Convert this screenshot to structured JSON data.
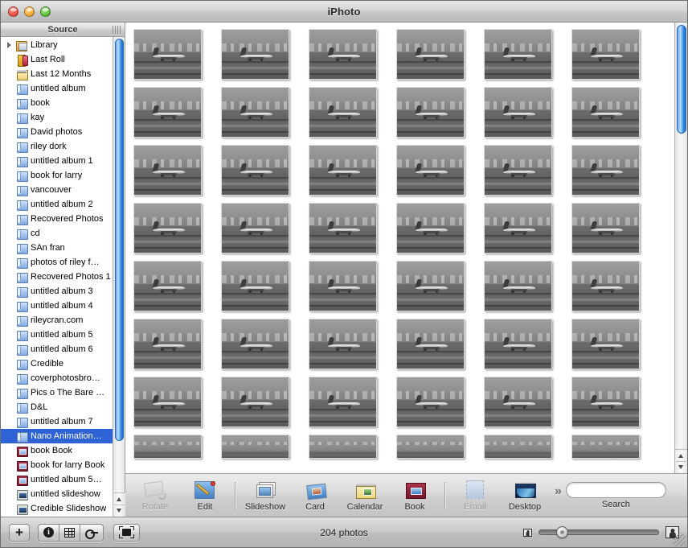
{
  "window": {
    "title": "iPhoto",
    "controls": {
      "close": "close-button",
      "minimize": "minimize-button",
      "zoom": "zoom-button"
    }
  },
  "sidebar": {
    "header": "Source",
    "items": [
      {
        "label": "Library",
        "icon": "library-icon",
        "disclosure": true,
        "selected": false
      },
      {
        "label": "Last Roll",
        "icon": "film-roll-icon",
        "disclosure": false,
        "selected": false
      },
      {
        "label": "Last 12 Months",
        "icon": "calendar-icon",
        "disclosure": false,
        "selected": false
      },
      {
        "label": "untitled album",
        "icon": "album-icon",
        "disclosure": false,
        "selected": false
      },
      {
        "label": "book",
        "icon": "album-icon",
        "disclosure": false,
        "selected": false
      },
      {
        "label": "kay",
        "icon": "album-icon",
        "disclosure": false,
        "selected": false
      },
      {
        "label": "David photos",
        "icon": "album-icon",
        "disclosure": false,
        "selected": false
      },
      {
        "label": "riley dork",
        "icon": "album-icon",
        "disclosure": false,
        "selected": false
      },
      {
        "label": "untitled album 1",
        "icon": "album-icon",
        "disclosure": false,
        "selected": false
      },
      {
        "label": "book for larry",
        "icon": "album-icon",
        "disclosure": false,
        "selected": false
      },
      {
        "label": "vancouver",
        "icon": "album-icon",
        "disclosure": false,
        "selected": false
      },
      {
        "label": "untitled album 2",
        "icon": "album-icon",
        "disclosure": false,
        "selected": false
      },
      {
        "label": "Recovered Photos",
        "icon": "album-icon",
        "disclosure": false,
        "selected": false
      },
      {
        "label": "cd",
        "icon": "album-icon",
        "disclosure": false,
        "selected": false
      },
      {
        "label": "SAn fran",
        "icon": "album-icon",
        "disclosure": false,
        "selected": false
      },
      {
        "label": "photos of riley f…",
        "icon": "album-icon",
        "disclosure": false,
        "selected": false
      },
      {
        "label": "Recovered Photos 1",
        "icon": "album-icon",
        "disclosure": false,
        "selected": false
      },
      {
        "label": "untitled album 3",
        "icon": "album-icon",
        "disclosure": false,
        "selected": false
      },
      {
        "label": "untitled album 4",
        "icon": "album-icon",
        "disclosure": false,
        "selected": false
      },
      {
        "label": "rileycran.com",
        "icon": "album-icon",
        "disclosure": false,
        "selected": false
      },
      {
        "label": "untitled album 5",
        "icon": "album-icon",
        "disclosure": false,
        "selected": false
      },
      {
        "label": "untitled album 6",
        "icon": "album-icon",
        "disclosure": false,
        "selected": false
      },
      {
        "label": "Credible",
        "icon": "album-icon",
        "disclosure": false,
        "selected": false
      },
      {
        "label": "coverphotosbro…",
        "icon": "album-icon",
        "disclosure": false,
        "selected": false
      },
      {
        "label": "Pics o The Bare …",
        "icon": "album-icon",
        "disclosure": false,
        "selected": false
      },
      {
        "label": "D&L",
        "icon": "album-icon",
        "disclosure": false,
        "selected": false
      },
      {
        "label": "untitled album 7",
        "icon": "album-icon",
        "disclosure": false,
        "selected": false
      },
      {
        "label": "Nano Animation…",
        "icon": "album-icon",
        "disclosure": false,
        "selected": true
      },
      {
        "label": "book Book",
        "icon": "book-icon",
        "disclosure": false,
        "selected": false
      },
      {
        "label": "book for larry Book",
        "icon": "book-icon",
        "disclosure": false,
        "selected": false
      },
      {
        "label": "untitled album 5…",
        "icon": "book-icon",
        "disclosure": false,
        "selected": false
      },
      {
        "label": "untitled slideshow",
        "icon": "slideshow-icon",
        "disclosure": false,
        "selected": false
      },
      {
        "label": "Credible Slideshow",
        "icon": "slideshow-icon",
        "disclosure": false,
        "selected": false
      }
    ],
    "selection_color": "#2f62d4"
  },
  "photo_grid": {
    "columns": 6,
    "full_rows": 7,
    "clipped_row": true,
    "thumbnail_description": "grayscale photo of a propeller airliner on an airport runway"
  },
  "toolbar": {
    "buttons": [
      {
        "label": "Rotate",
        "icon": "rotate-icon",
        "enabled": false
      },
      {
        "label": "Edit",
        "icon": "edit-icon",
        "enabled": true
      },
      {
        "label": "Slideshow",
        "icon": "slideshow-icon",
        "enabled": true
      },
      {
        "label": "Card",
        "icon": "card-icon",
        "enabled": true
      },
      {
        "label": "Calendar",
        "icon": "calendar-icon",
        "enabled": true
      },
      {
        "label": "Book",
        "icon": "book-icon",
        "enabled": true
      },
      {
        "label": "Email",
        "icon": "email-icon",
        "enabled": false
      },
      {
        "label": "Desktop",
        "icon": "desktop-icon",
        "enabled": true
      }
    ],
    "overflow": "»",
    "search": {
      "label": "Search",
      "value": "",
      "placeholder": ""
    }
  },
  "statusbar": {
    "add_label": "+",
    "segmented": [
      {
        "name": "info",
        "glyph": "i"
      },
      {
        "name": "calendar",
        "glyph": ""
      },
      {
        "name": "keywords",
        "glyph": ""
      }
    ],
    "fullscreen": "fullscreen-icon",
    "count": "204 photos",
    "zoom": {
      "min_icon": "small-thumbnail-icon",
      "max_icon": "large-thumbnail-icon",
      "value": 19
    }
  }
}
